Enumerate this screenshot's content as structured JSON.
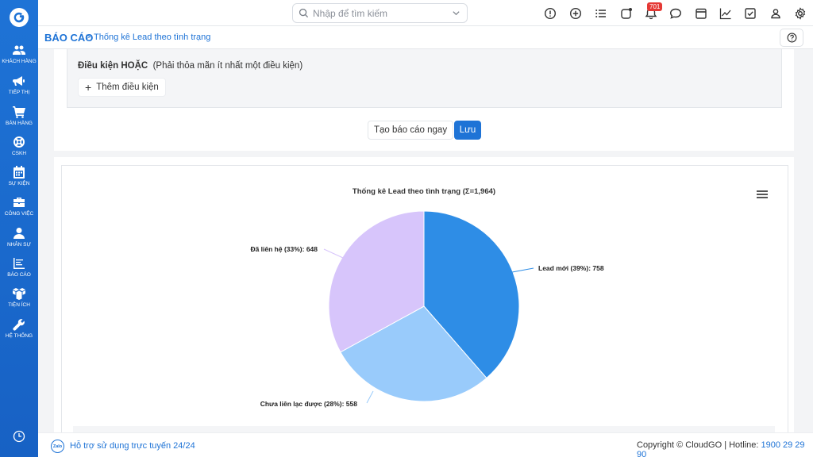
{
  "sidebar": {
    "items": [
      {
        "label": "KHÁCH HÀNG",
        "icon": "users-icon"
      },
      {
        "label": "TIẾP THỊ",
        "icon": "megaphone-icon"
      },
      {
        "label": "BÁN HÀNG",
        "icon": "cart-icon"
      },
      {
        "label": "CSKH",
        "icon": "lifebuoy-icon"
      },
      {
        "label": "SỰ KIỆN",
        "icon": "calendar-icon"
      },
      {
        "label": "CÔNG VIỆC",
        "icon": "briefcase-icon"
      },
      {
        "label": "NHÂN SỰ",
        "icon": "person-icon"
      },
      {
        "label": "BÁO CÁO",
        "icon": "report-icon"
      },
      {
        "label": "TIỆN ÍCH",
        "icon": "boxes-icon"
      },
      {
        "label": "HỆ THỐNG",
        "icon": "wrench-icon"
      }
    ]
  },
  "topbar": {
    "search_placeholder": "Nhập để tìm kiếm",
    "notification_count": "701"
  },
  "breadcrumb": {
    "root": "BÁO CÁO",
    "separator": ">",
    "page": "Thống kê Lead theo tình trạng"
  },
  "conditions": {
    "title_bold": "Điều kiện HOẶC",
    "title_note": "(Phải thỏa mãn ít nhất một điều kiện)",
    "add_label": "Thêm điều kiện"
  },
  "actions": {
    "run_label": "Tạo báo cáo ngay",
    "save_label": "Lưu"
  },
  "chart_data": {
    "type": "pie",
    "title": "Thống kê Lead theo tình trạng (Σ=1,964)",
    "slices": [
      {
        "name": "Lead mới",
        "percent": 39,
        "value": 758,
        "label": "Lead mới (39%): 758",
        "color": "#2e8de6"
      },
      {
        "name": "Chưa liên lạc được",
        "percent": 28,
        "value": 558,
        "label": "Chưa liên lạc được (28%): 558",
        "color": "#99cbfb"
      },
      {
        "name": "Đã liên hệ",
        "percent": 33,
        "value": 648,
        "label": "Đã liên hệ (33%): 648",
        "color": "#d7c5fb"
      }
    ],
    "total": 1964
  },
  "footer": {
    "support_icon_text": "Zalo",
    "support_text": "Hỗ trợ sử dụng trực tuyến 24/24",
    "copyright": "Copyright © CloudGO | Hotline: ",
    "hotline": "1900 29 29 90"
  }
}
